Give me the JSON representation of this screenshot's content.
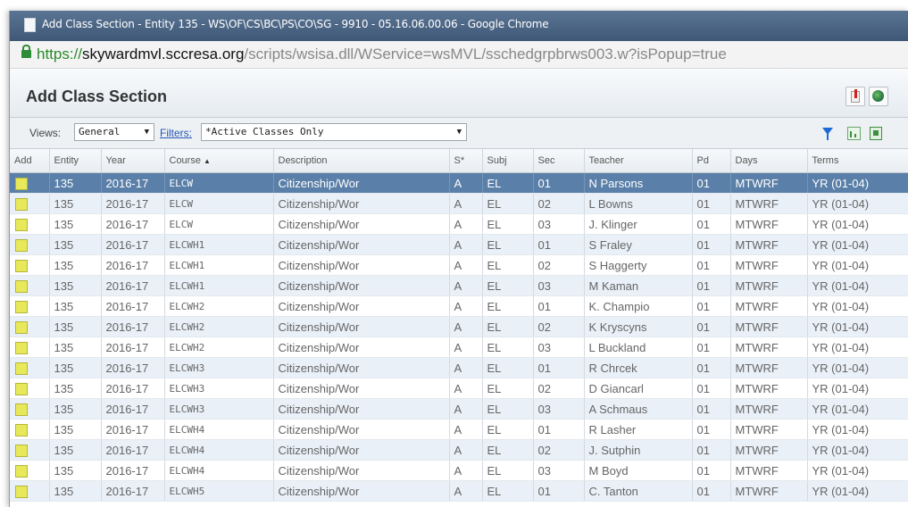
{
  "window": {
    "title": "Add Class Section - Entity 135 - WS\\OF\\CS\\BC\\PS\\CO\\SG - 9910 - 05.16.06.00.06 - Google Chrome"
  },
  "address": {
    "scheme": "https://",
    "host": "skywardmvl.sccresa.org",
    "path": "/scripts/wsisa.dll/WService=wsMVL/sschedgrpbrws003.w?isPopup=true"
  },
  "panel": {
    "title": "Add Class Section"
  },
  "toolbar": {
    "views_label": "Views:",
    "views_value": "General",
    "filters_label": "Filters:",
    "filters_value": "*Active Classes Only"
  },
  "icons": {
    "report": "report-icon",
    "globe": "globe-icon",
    "filter": "funnel-icon",
    "chart": "chart-icon",
    "export": "export-icon",
    "lock": "lock-icon",
    "add_box_color": "#e7e85a",
    "selected_row_color": "#5a7fa8"
  },
  "grid": {
    "sorted_by": "Course",
    "sort_direction": "ascending",
    "columns": [
      "Add",
      "Entity",
      "Year",
      "Course",
      "Description",
      "S*",
      "Subj",
      "Sec",
      "Teacher",
      "Pd",
      "Days",
      "Terms"
    ],
    "rows": [
      {
        "entity": "135",
        "year": "2016-17",
        "course": "ELCW",
        "description": "Citizenship/Wor",
        "s": "A",
        "subj": "EL",
        "sec": "01",
        "teacher": "N Parsons",
        "pd": "01",
        "days": "MTWRF",
        "terms": "YR (01-04)"
      },
      {
        "entity": "135",
        "year": "2016-17",
        "course": "ELCW",
        "description": "Citizenship/Wor",
        "s": "A",
        "subj": "EL",
        "sec": "02",
        "teacher": "L Bowns",
        "pd": "01",
        "days": "MTWRF",
        "terms": "YR (01-04)"
      },
      {
        "entity": "135",
        "year": "2016-17",
        "course": "ELCW",
        "description": "Citizenship/Wor",
        "s": "A",
        "subj": "EL",
        "sec": "03",
        "teacher": "J. Klinger",
        "pd": "01",
        "days": "MTWRF",
        "terms": "YR (01-04)"
      },
      {
        "entity": "135",
        "year": "2016-17",
        "course": "ELCWH1",
        "description": "Citizenship/Wor",
        "s": "A",
        "subj": "EL",
        "sec": "01",
        "teacher": "S Fraley",
        "pd": "01",
        "days": "MTWRF",
        "terms": "YR (01-04)"
      },
      {
        "entity": "135",
        "year": "2016-17",
        "course": "ELCWH1",
        "description": "Citizenship/Wor",
        "s": "A",
        "subj": "EL",
        "sec": "02",
        "teacher": "S Haggerty",
        "pd": "01",
        "days": "MTWRF",
        "terms": "YR (01-04)"
      },
      {
        "entity": "135",
        "year": "2016-17",
        "course": "ELCWH1",
        "description": "Citizenship/Wor",
        "s": "A",
        "subj": "EL",
        "sec": "03",
        "teacher": "M Kaman",
        "pd": "01",
        "days": "MTWRF",
        "terms": "YR (01-04)"
      },
      {
        "entity": "135",
        "year": "2016-17",
        "course": "ELCWH2",
        "description": "Citizenship/Wor",
        "s": "A",
        "subj": "EL",
        "sec": "01",
        "teacher": "K. Champio",
        "pd": "01",
        "days": "MTWRF",
        "terms": "YR (01-04)"
      },
      {
        "entity": "135",
        "year": "2016-17",
        "course": "ELCWH2",
        "description": "Citizenship/Wor",
        "s": "A",
        "subj": "EL",
        "sec": "02",
        "teacher": "K Kryscyns",
        "pd": "01",
        "days": "MTWRF",
        "terms": "YR (01-04)"
      },
      {
        "entity": "135",
        "year": "2016-17",
        "course": "ELCWH2",
        "description": "Citizenship/Wor",
        "s": "A",
        "subj": "EL",
        "sec": "03",
        "teacher": "L Buckland",
        "pd": "01",
        "days": "MTWRF",
        "terms": "YR (01-04)"
      },
      {
        "entity": "135",
        "year": "2016-17",
        "course": "ELCWH3",
        "description": "Citizenship/Wor",
        "s": "A",
        "subj": "EL",
        "sec": "01",
        "teacher": "R Chrcek",
        "pd": "01",
        "days": "MTWRF",
        "terms": "YR (01-04)"
      },
      {
        "entity": "135",
        "year": "2016-17",
        "course": "ELCWH3",
        "description": "Citizenship/Wor",
        "s": "A",
        "subj": "EL",
        "sec": "02",
        "teacher": "D Giancarl",
        "pd": "01",
        "days": "MTWRF",
        "terms": "YR (01-04)"
      },
      {
        "entity": "135",
        "year": "2016-17",
        "course": "ELCWH3",
        "description": "Citizenship/Wor",
        "s": "A",
        "subj": "EL",
        "sec": "03",
        "teacher": "A Schmaus",
        "pd": "01",
        "days": "MTWRF",
        "terms": "YR (01-04)"
      },
      {
        "entity": "135",
        "year": "2016-17",
        "course": "ELCWH4",
        "description": "Citizenship/Wor",
        "s": "A",
        "subj": "EL",
        "sec": "01",
        "teacher": "R Lasher",
        "pd": "01",
        "days": "MTWRF",
        "terms": "YR (01-04)"
      },
      {
        "entity": "135",
        "year": "2016-17",
        "course": "ELCWH4",
        "description": "Citizenship/Wor",
        "s": "A",
        "subj": "EL",
        "sec": "02",
        "teacher": "J. Sutphin",
        "pd": "01",
        "days": "MTWRF",
        "terms": "YR (01-04)"
      },
      {
        "entity": "135",
        "year": "2016-17",
        "course": "ELCWH4",
        "description": "Citizenship/Wor",
        "s": "A",
        "subj": "EL",
        "sec": "03",
        "teacher": "M Boyd",
        "pd": "01",
        "days": "MTWRF",
        "terms": "YR (01-04)"
      },
      {
        "entity": "135",
        "year": "2016-17",
        "course": "ELCWH5",
        "description": "Citizenship/Wor",
        "s": "A",
        "subj": "EL",
        "sec": "01",
        "teacher": "C. Tanton",
        "pd": "01",
        "days": "MTWRF",
        "terms": "YR (01-04)"
      }
    ]
  }
}
